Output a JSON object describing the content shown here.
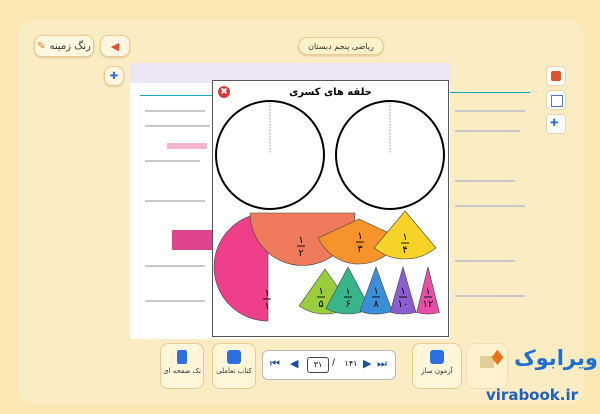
{
  "header": {
    "background_button_label": "رنگ زمینه",
    "book_title": "ریاضی پنجم دبستان"
  },
  "modal": {
    "title": "حلقه های کسری",
    "close_glyph": "✖",
    "pieces": [
      {
        "num": "1",
        "den": "1",
        "color": "#ef3f8b"
      },
      {
        "num": "1",
        "den": "2",
        "color": "#ef7b5c"
      },
      {
        "num": "1",
        "den": "3",
        "color": "#f6932a"
      },
      {
        "num": "1",
        "den": "4",
        "color": "#f6d326"
      },
      {
        "num": "1",
        "den": "5",
        "color": "#9acd3b"
      },
      {
        "num": "1",
        "den": "6",
        "color": "#38b68a"
      },
      {
        "num": "1",
        "den": "8",
        "color": "#3a8fd8"
      },
      {
        "num": "1",
        "den": "10",
        "color": "#8a5ed0"
      },
      {
        "num": "1",
        "den": "12",
        "color": "#e74fa7"
      }
    ]
  },
  "bottom_bar": {
    "single_page_label": "تک صفحه ای",
    "interactive_book_label": "کتاب تعاملی",
    "quiz_maker_label": "آزمون ساز",
    "current_page": "۳۱",
    "total_pages": "۱۴۱",
    "separator": "/"
  },
  "brand": {
    "logo_text": "ویرابوک",
    "url": "virabook.ir"
  }
}
